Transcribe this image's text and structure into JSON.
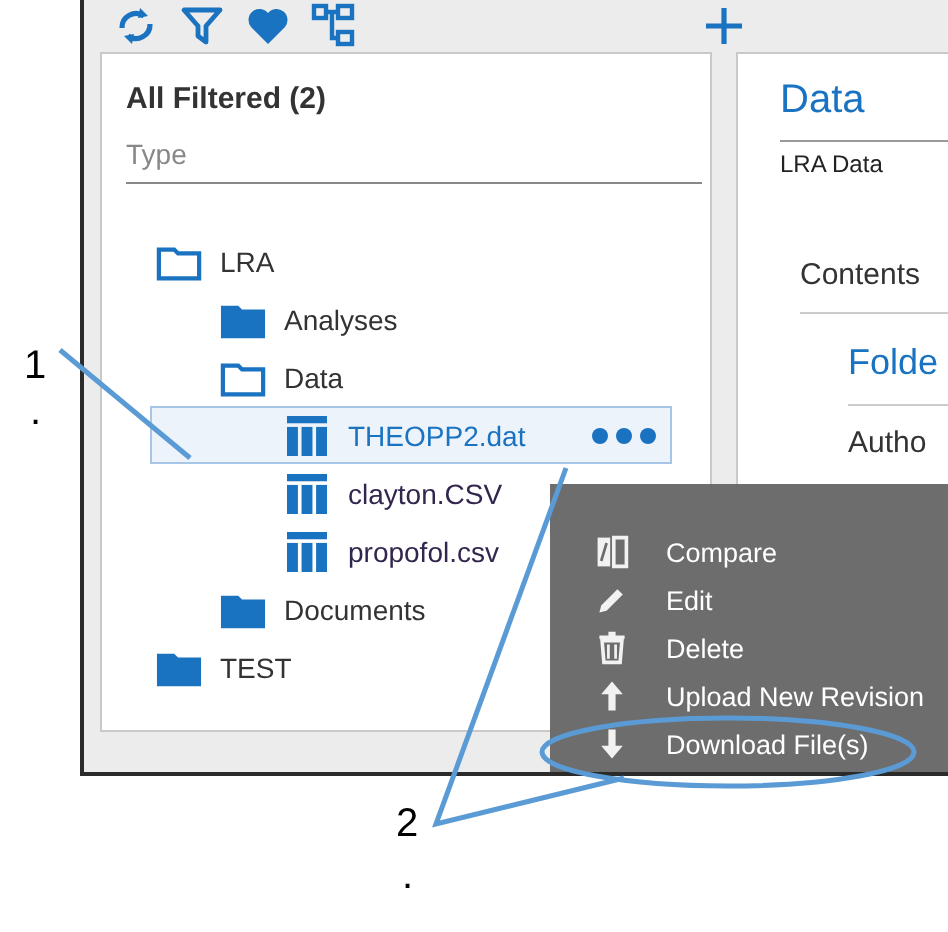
{
  "left_panel": {
    "title": "All Filtered (2)",
    "filter": {
      "placeholder": "Type"
    },
    "tree": [
      {
        "label": "LRA",
        "kind": "folder",
        "expanded": true,
        "selected": false,
        "children": [
          {
            "label": "Analyses",
            "kind": "folder",
            "expanded": false,
            "selected": false
          },
          {
            "label": "Data",
            "kind": "folder",
            "expanded": true,
            "selected": false,
            "children": [
              {
                "label": "THEOPP2.dat",
                "kind": "file",
                "selected": true
              },
              {
                "label": "clayton.CSV",
                "kind": "file",
                "selected": false
              },
              {
                "label": "propofol.csv",
                "kind": "file",
                "selected": false
              }
            ]
          },
          {
            "label": "Documents",
            "kind": "folder",
            "expanded": false,
            "selected": false
          }
        ]
      },
      {
        "label": "TEST",
        "kind": "folder",
        "expanded": false,
        "selected": false
      }
    ]
  },
  "right_panel": {
    "title": "Data",
    "subtitle": "LRA Data",
    "section": "Contents",
    "heading": "Folde",
    "field_label": "Autho"
  },
  "context_menu": [
    {
      "label": "Compare",
      "kind": "compare"
    },
    {
      "label": "Edit",
      "kind": "edit"
    },
    {
      "label": "Delete",
      "kind": "delete"
    },
    {
      "label": "Upload New Revision",
      "kind": "upload"
    },
    {
      "label": "Download File(s)",
      "kind": "download"
    }
  ],
  "callouts": [
    {
      "number": "1",
      "mark": "."
    },
    {
      "number": "2",
      "mark": "."
    }
  ]
}
